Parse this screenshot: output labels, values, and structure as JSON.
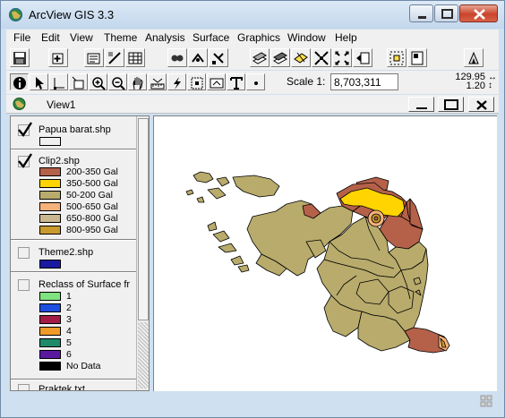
{
  "app": {
    "title": "ArcView GIS 3.3",
    "icon": "globe-icon"
  },
  "menu": [
    "File",
    "Edit",
    "View",
    "Theme",
    "Analysis",
    "Surface",
    "Graphics",
    "Window",
    "Help"
  ],
  "toolbar2": {
    "scale_label": "Scale 1:",
    "scale_value": "8,703,311",
    "coord_x": "129.95",
    "coord_y": "1.20"
  },
  "view": {
    "title": "View1",
    "icon": "view-globe-icon"
  },
  "toc": {
    "themes": [
      {
        "name": "Papua barat.shp",
        "checked": true,
        "legend": [
          {
            "label": "",
            "color": "#f0f0f0"
          }
        ]
      },
      {
        "name": "Clip2.shp",
        "checked": true,
        "legend": [
          {
            "label": "200-350 Gal",
            "color": "#b5614a"
          },
          {
            "label": "350-500 Gal",
            "color": "#ffd400"
          },
          {
            "label": "50-200 Gal",
            "color": "#b8ab6c"
          },
          {
            "label": "500-650 Gal",
            "color": "#f6b27a"
          },
          {
            "label": "650-800 Gal",
            "color": "#c8b78f"
          },
          {
            "label": "800-950 Gal",
            "color": "#c99a2e"
          }
        ]
      },
      {
        "name": "Theme2.shp",
        "checked": false,
        "legend": [
          {
            "label": "",
            "color": "#1a1aa0"
          }
        ]
      },
      {
        "name": "Reclass of Surface fr",
        "checked": false,
        "legend": [
          {
            "label": "1",
            "color": "#7fe37f"
          },
          {
            "label": "2",
            "color": "#1f4fe0"
          },
          {
            "label": "3",
            "color": "#a31c48"
          },
          {
            "label": "4",
            "color": "#f09a2a"
          },
          {
            "label": "5",
            "color": "#1e8a6a"
          },
          {
            "label": "6",
            "color": "#5a1aa0"
          },
          {
            "label": "No Data",
            "color": "#000000"
          }
        ]
      },
      {
        "name": "Praktek.txt",
        "checked": false,
        "legend": []
      }
    ]
  },
  "map_colors": {
    "low": "#b8ab6c",
    "mid": "#b5614a",
    "high": "#ffd400",
    "peak": "#f6b27a",
    "peak2": "#c99a2e"
  }
}
